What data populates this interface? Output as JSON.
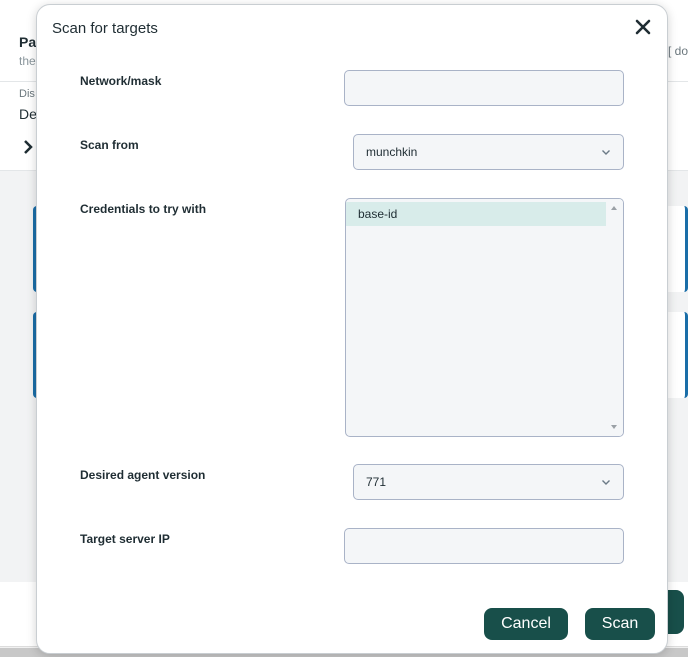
{
  "background": {
    "title": "Pa",
    "subtitle": "the",
    "right_text": "[ doc",
    "filter_label": "Dis",
    "filter_value": "De",
    "expand_icon": "chevron-right-icon"
  },
  "dialog": {
    "title": "Scan for targets",
    "close_icon": "close-icon",
    "fields": {
      "network_mask": {
        "label": "Network/mask",
        "value": "",
        "placeholder": ""
      },
      "scan_from": {
        "label": "Scan from",
        "selected": "munchkin"
      },
      "credentials": {
        "label": "Credentials to try with",
        "items": [
          "base-id"
        ],
        "selected_index": 0
      },
      "agent_version": {
        "label": "Desired agent version",
        "selected": "771"
      },
      "target_server_ip": {
        "label": "Target server IP",
        "value": "",
        "placeholder": ""
      }
    },
    "buttons": {
      "cancel_label": "Cancel",
      "scan_label": "Scan"
    }
  },
  "colors": {
    "primary_button": "#184f4a",
    "selected_item": "#d8ecea",
    "input_border": "#a9b3c7",
    "accent_blue": "#1a6ea8"
  }
}
